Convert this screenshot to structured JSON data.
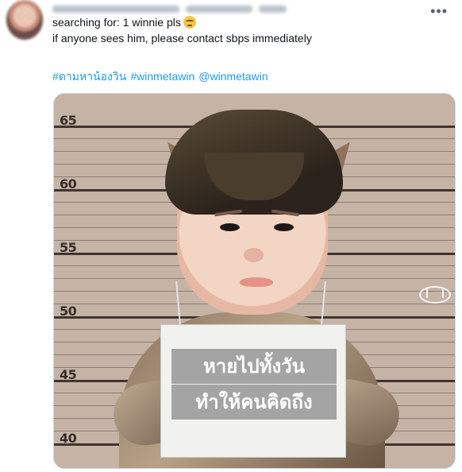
{
  "tweet": {
    "more_icon": "more-horizontal-icon",
    "text_line1": "searching for: 1 winnie pls",
    "text_line2": "if anyone sees him, please contact sbps immediately",
    "hashtag1": "#ตามหาน้องวิน",
    "hashtag2": "#winmetawin",
    "mention": "@winmetawin"
  },
  "image": {
    "height_labels": [
      "65",
      "60",
      "55",
      "50",
      "45",
      "40"
    ],
    "sign_line1": "หายไปทั้งวัน",
    "sign_line2": "ทำให้คนคิดถึง"
  },
  "colors": {
    "link": "#1d9bf0",
    "text": "#0f1419",
    "secondary": "#536471"
  }
}
